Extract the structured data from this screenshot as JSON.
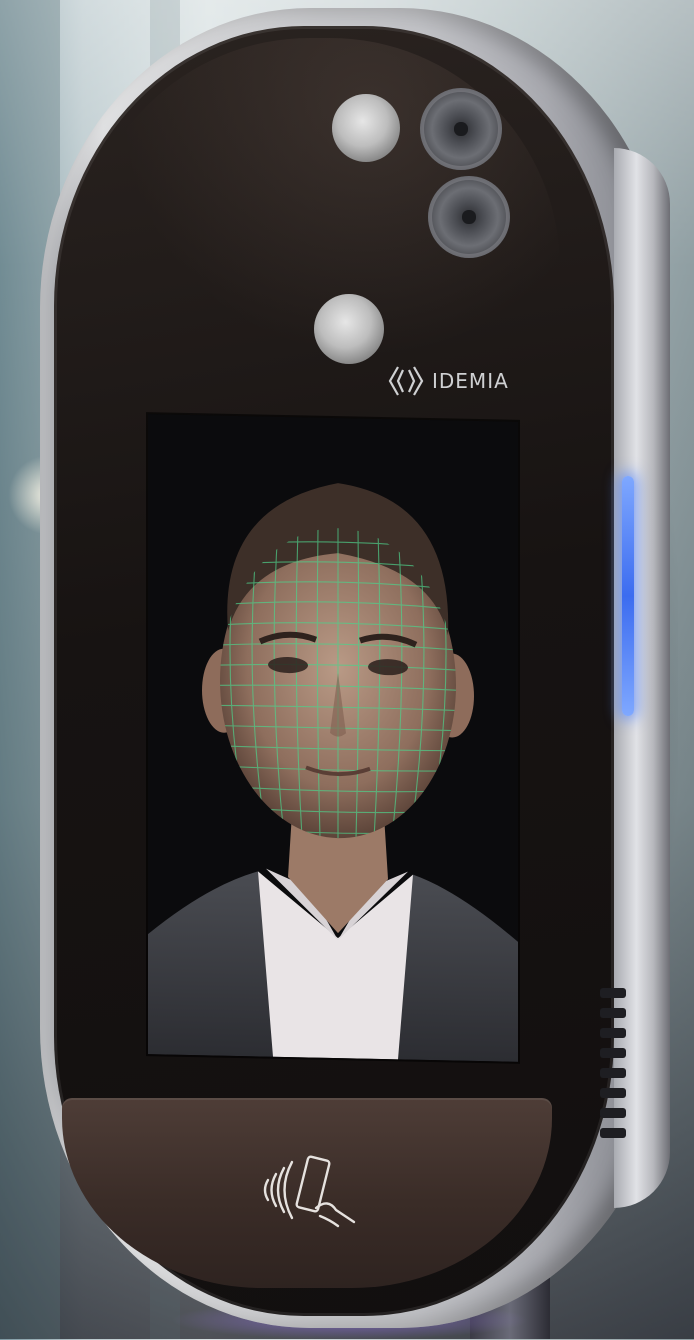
{
  "device": {
    "brand_name": "IDEMIA",
    "led_color": "#3c6cf0",
    "housing_color": "#c3c4c8",
    "face_color": "#171312",
    "reader_color": "#3a2c27"
  },
  "screen": {
    "mesh_color": "#4fd08a",
    "background_color": "#0a0b0c"
  },
  "icons": {
    "brand_logo": "idemia-chevrons-icon",
    "reader": "contactless-card-icon"
  }
}
